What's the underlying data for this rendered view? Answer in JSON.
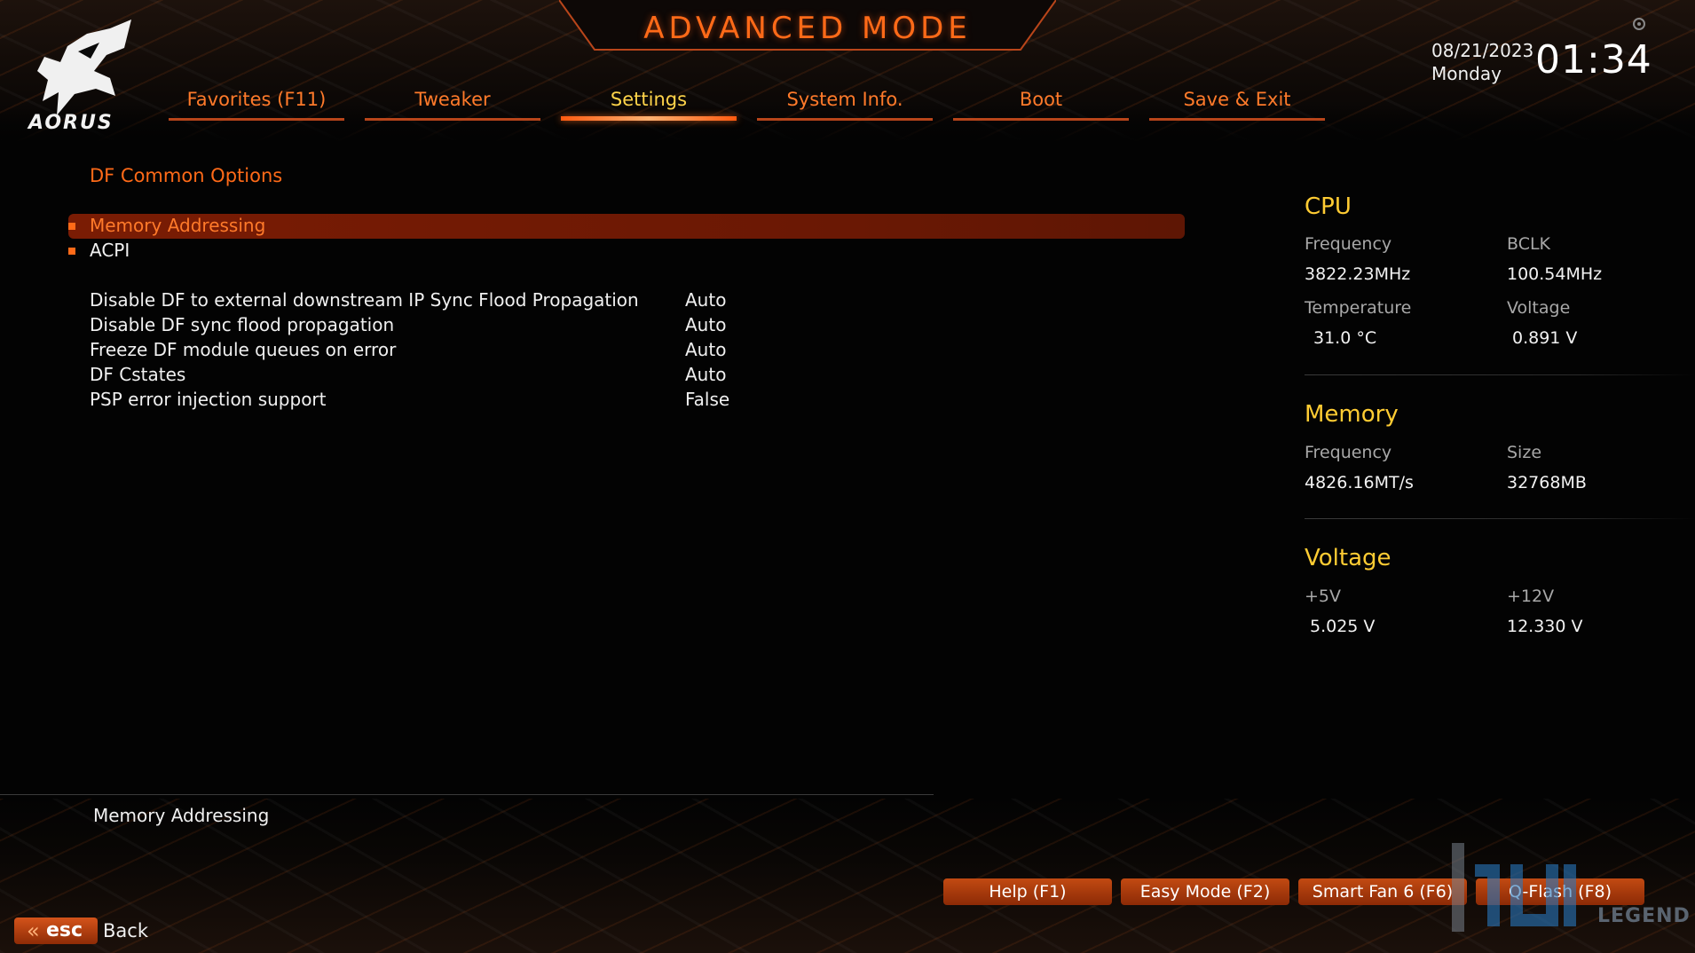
{
  "header": {
    "title": "ADVANCED MODE",
    "brand": "AORUS",
    "date": "08/21/2023",
    "weekday": "Monday",
    "time": "01:34"
  },
  "tabs": [
    {
      "label": "Favorites (F11)",
      "active": false
    },
    {
      "label": "Tweaker",
      "active": false
    },
    {
      "label": "Settings",
      "active": true
    },
    {
      "label": "System Info.",
      "active": false
    },
    {
      "label": "Boot",
      "active": false
    },
    {
      "label": "Save & Exit",
      "active": false
    }
  ],
  "main": {
    "section_title": "DF Common Options",
    "menu": [
      {
        "label": "Memory Addressing",
        "selected": true
      },
      {
        "label": "ACPI",
        "selected": false
      }
    ],
    "options": [
      {
        "label": "Disable DF to external downstream IP Sync Flood Propagation",
        "value": "Auto"
      },
      {
        "label": "Disable DF sync flood propagation",
        "value": "Auto"
      },
      {
        "label": "Freeze DF module queues on error",
        "value": "Auto"
      },
      {
        "label": "DF Cstates",
        "value": "Auto"
      },
      {
        "label": "PSP error injection support",
        "value": "False"
      }
    ]
  },
  "sidebar": {
    "cpu": {
      "heading": "CPU",
      "freq_label": "Frequency",
      "freq_value": "3822.23MHz",
      "bclk_label": "BCLK",
      "bclk_value": "100.54MHz",
      "temp_label": "Temperature",
      "temp_value": "31.0 °C",
      "volt_label": "Voltage",
      "volt_value": "0.891 V"
    },
    "memory": {
      "heading": "Memory",
      "freq_label": "Frequency",
      "freq_value": "4826.16MT/s",
      "size_label": "Size",
      "size_value": "32768MB"
    },
    "voltage": {
      "heading": "Voltage",
      "v5_label": "+5V",
      "v5_value": "5.025 V",
      "v12_label": "+12V",
      "v12_value": "12.330 V"
    }
  },
  "description": "Memory Addressing",
  "footer": {
    "help": "Help (F1)",
    "easy_mode": "Easy Mode (F2)",
    "smart_fan": "Smart Fan 6 (F6)",
    "qflash": "Q-Flash (F8)",
    "esc": "esc",
    "back": "Back"
  },
  "watermark": {
    "text": "LEGEND"
  },
  "colors": {
    "accent": "#ff6a18",
    "active_tab": "#ffd44a",
    "heading": "#ffcc33",
    "selection_bar": "#7a1c04"
  }
}
